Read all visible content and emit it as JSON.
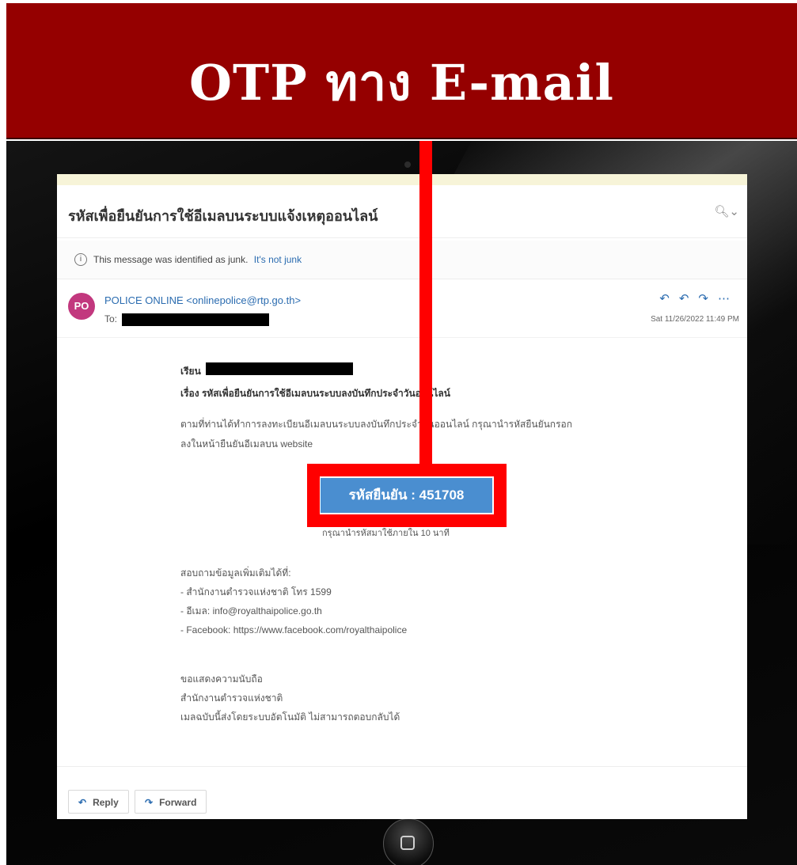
{
  "banner": {
    "title": "OTP ทาง E-mail"
  },
  "email": {
    "subject": "รหัสเพื่อยืนยันการใช้อีเมลบนระบบแจ้งเหตุออนไลน์",
    "junk_notice": "This message was identified as junk.",
    "not_junk_link": "It's not junk",
    "avatar_initials": "PO",
    "sender": "POLICE ONLINE <onlinepolice@rtp.go.th>",
    "to_label": "To:",
    "date": "Sat 11/26/2022 11:49 PM",
    "greeting": "เรียน",
    "body_subject": "เรื่อง รหัสเพื่อยืนยันการใช้อีเมลบนระบบลงบันทึกประจำวันออนไลน์",
    "intro_line1": "ตามที่ท่านได้ทำการลงทะเบียนอีเมลบนระบบลงบันทึกประจำวันออนไลน์ กรุณานำรหัสยืนยันกรอก",
    "intro_line2": "ลงในหน้ายืนยันอีเมลบน website",
    "otp_label": "รหัสยืนยัน : 451708",
    "expire_note": "กรุณานำรหัสมาใช้ภายใน 10 นาที",
    "contact_heading": "สอบถามข้อมูลเพิ่มเติมได้ที่:",
    "contact_phone": "- สำนักงานตำรวจแห่งชาติ โทร 1599",
    "contact_email": "- อีเมล: info@royalthaipolice.go.th",
    "contact_facebook": "- Facebook: https://www.facebook.com/royalthaipolice",
    "closing1": "ขอแสดงความนับถือ",
    "closing2": "สำนักงานตำรวจแห่งชาติ",
    "closing3": "เมลฉบับนี้ส่งโดยระบบอัตโนมัติ ไม่สามารถตอบกลับได้",
    "reply_label": "Reply",
    "forward_label": "Forward"
  },
  "colors": {
    "banner": "#950000",
    "highlight": "#ff0000",
    "otp_button": "#4a8ed0",
    "avatar": "#c2387e"
  }
}
